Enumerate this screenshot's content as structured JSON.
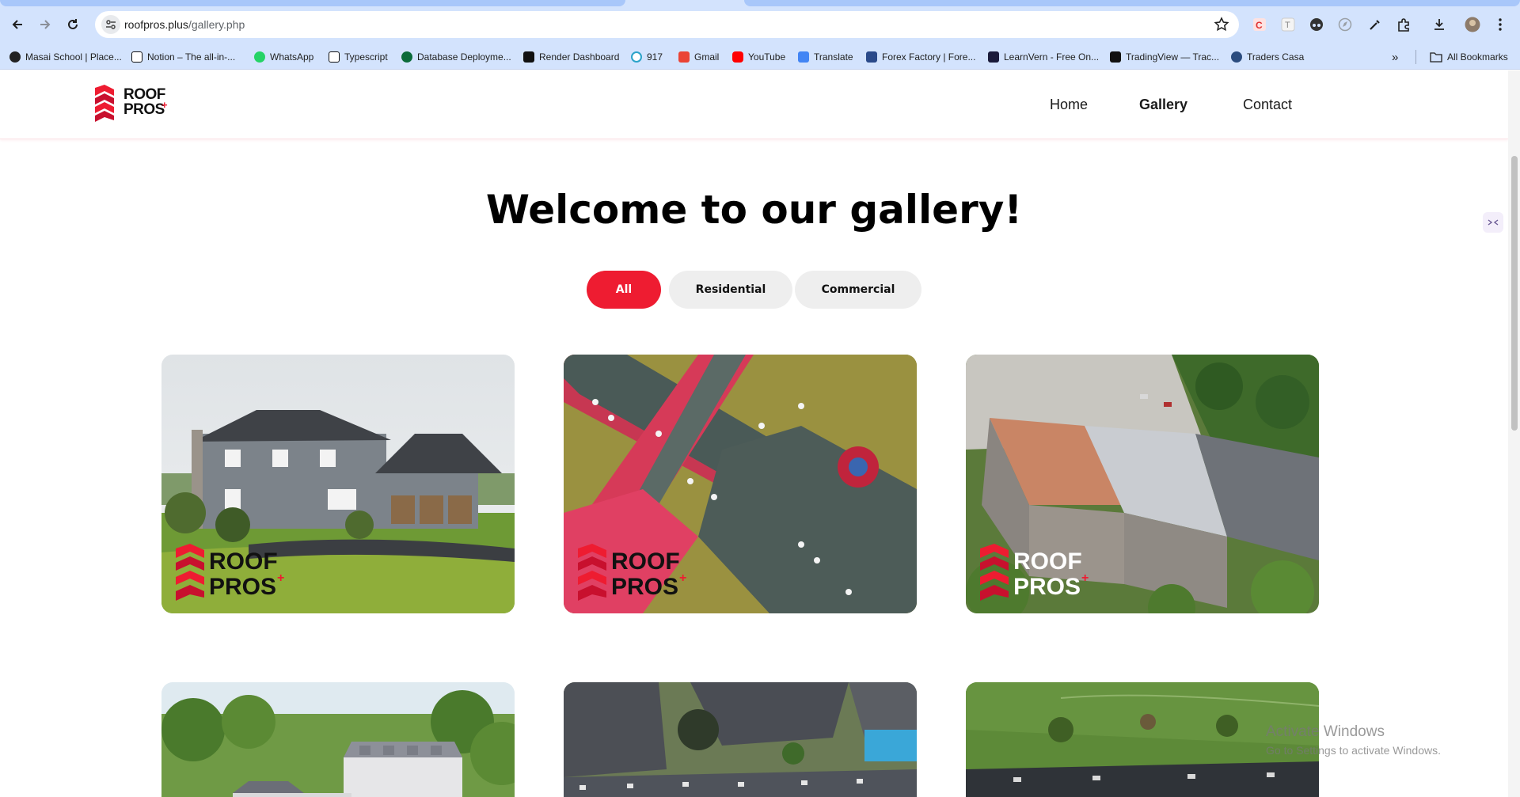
{
  "browser": {
    "url_host": "roofpros.plus",
    "url_path": "/gallery.php",
    "bookmarks": [
      {
        "label": "Masai School | Place...",
        "color": "#222222"
      },
      {
        "label": "Notion – The all-in-...",
        "color": "#111111"
      },
      {
        "label": "WhatsApp",
        "color": "#25d366"
      },
      {
        "label": "Typescript",
        "color": "#111111"
      },
      {
        "label": "Database Deployme...",
        "color": "#0b6b3a"
      },
      {
        "label": "Render Dashboard",
        "color": "#111111"
      },
      {
        "label": "917",
        "color": "#2ba3c9"
      },
      {
        "label": "Gmail",
        "color": "#ea4335"
      },
      {
        "label": "YouTube",
        "color": "#ff0000"
      },
      {
        "label": "Translate",
        "color": "#4285f4"
      },
      {
        "label": "Forex Factory | Fore...",
        "color": "#2a4a8a"
      },
      {
        "label": "LearnVern - Free On...",
        "color": "#1b1b3a"
      },
      {
        "label": "TradingView — Trac...",
        "color": "#111111"
      },
      {
        "label": "Traders Casa",
        "color": "#2b4c7e"
      }
    ],
    "more_bookmarks": "»",
    "all_bookmarks": "All Bookmarks"
  },
  "site": {
    "logo_line1": "ROOF",
    "logo_line2": "PROS",
    "brand_color": "#ee1c31",
    "nav": [
      {
        "label": "Home",
        "active": false
      },
      {
        "label": "Gallery",
        "active": true
      },
      {
        "label": "Contact",
        "active": false
      }
    ]
  },
  "gallery": {
    "title": "Welcome to our gallery!",
    "filters": [
      {
        "label": "All",
        "active": true
      },
      {
        "label": "Residential",
        "active": false
      },
      {
        "label": "Commercial",
        "active": false
      }
    ],
    "watermark_line1": "ROOF",
    "watermark_line2": "PROS",
    "images": [
      {
        "subject": "two-story gray house with lawn"
      },
      {
        "subject": "aerial view of red building with green shingle roofs"
      },
      {
        "subject": "aerial view of apartment buildings with new roofs"
      },
      {
        "subject": "house with dormers surrounded by trees"
      },
      {
        "subject": "aerial view of neighborhood roofs and pool"
      },
      {
        "subject": "aerial view of dark flat roof and lawn"
      }
    ]
  },
  "os_watermark": {
    "line1": "Activate Windows",
    "line2": "Go to Settings to activate Windows."
  }
}
